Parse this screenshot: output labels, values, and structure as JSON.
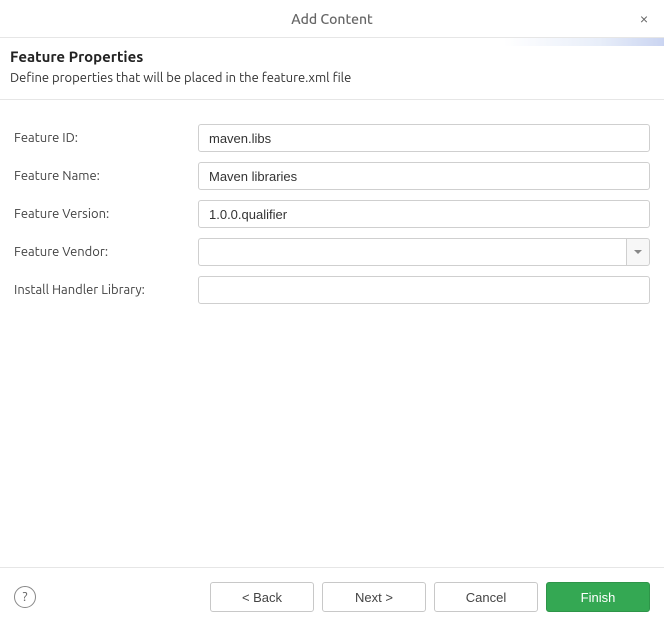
{
  "dialog": {
    "title": "Add Content"
  },
  "banner": {
    "heading": "Feature Properties",
    "description": "Define properties that will be placed in the feature.xml file"
  },
  "form": {
    "feature_id": {
      "label": "Feature ID:",
      "value": "maven.libs"
    },
    "feature_name": {
      "label": "Feature Name:",
      "value": "Maven libraries"
    },
    "feature_version": {
      "label": "Feature Version:",
      "value": "1.0.0.qualifier"
    },
    "feature_vendor": {
      "label": "Feature Vendor:",
      "value": ""
    },
    "install_handler": {
      "label": "Install Handler Library:",
      "value": ""
    }
  },
  "buttons": {
    "back": "< Back",
    "next": "Next >",
    "cancel": "Cancel",
    "finish": "Finish"
  }
}
